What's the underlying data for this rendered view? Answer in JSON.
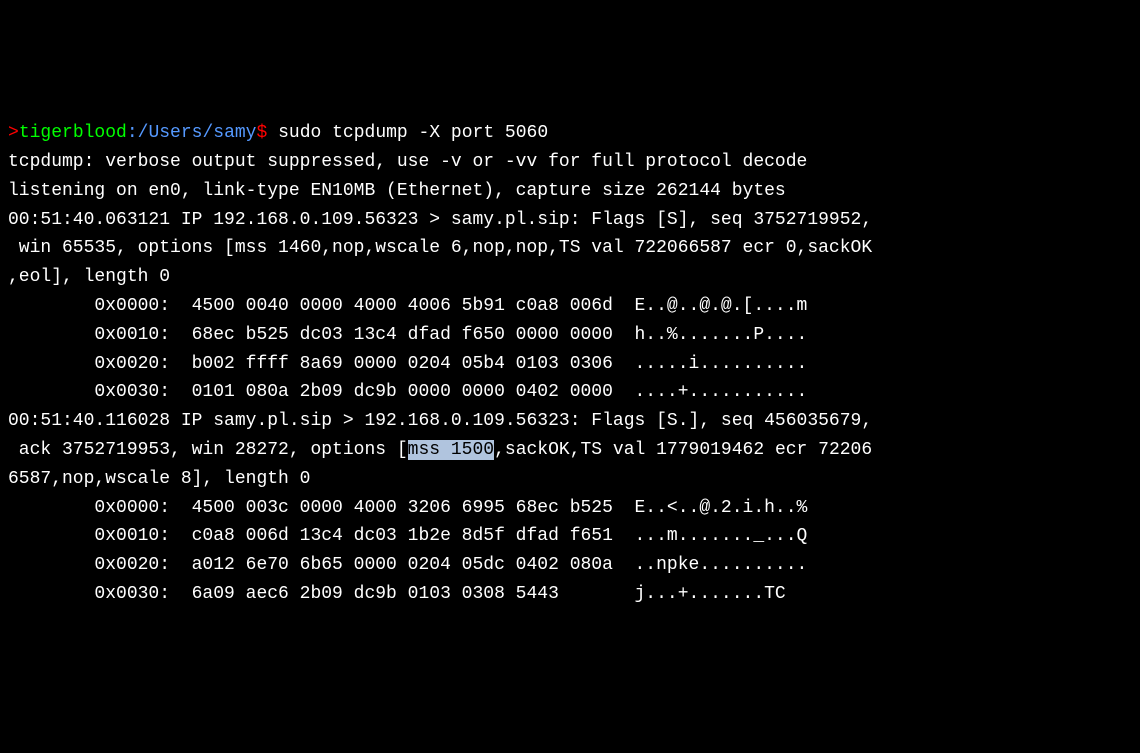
{
  "prompt": {
    "marker": ">",
    "host": "tigerblood",
    "sep": ":",
    "path": "/Users/samy",
    "dollar": "$",
    "command": " sudo tcpdump -X port 5060"
  },
  "output": {
    "line1": "tcpdump: verbose output suppressed, use -v or -vv for full protocol decode",
    "line2": "listening on en0, link-type EN10MB (Ethernet), capture size 262144 bytes",
    "line3": "00:51:40.063121 IP 192.168.0.109.56323 > samy.pl.sip: Flags [S], seq 3752719952,",
    "line4": " win 65535, options [mss 1460,nop,wscale 6,nop,nop,TS val 722066587 ecr 0,sackOK",
    "line5": ",eol], length 0",
    "hex1_0": "        0x0000:  4500 0040 0000 4000 4006 5b91 c0a8 006d  E..@..@.@.[....m",
    "hex1_1": "        0x0010:  68ec b525 dc03 13c4 dfad f650 0000 0000  h..%.......P....",
    "hex1_2": "        0x0020:  b002 ffff 8a69 0000 0204 05b4 0103 0306  .....i..........",
    "hex1_3": "        0x0030:  0101 080a 2b09 dc9b 0000 0000 0402 0000  ....+...........",
    "line6": "00:51:40.116028 IP samy.pl.sip > 192.168.0.109.56323: Flags [S.], seq 456035679,",
    "line7_pre": " ack 3752719953, win 28272, options [",
    "line7_hl": "mss 1500",
    "line7_post": ",sackOK,TS val 1779019462 ecr 72206",
    "line8": "6587,nop,wscale 8], length 0",
    "hex2_0": "        0x0000:  4500 003c 0000 4000 3206 6995 68ec b525  E..<..@.2.i.h..%",
    "hex2_1": "        0x0010:  c0a8 006d 13c4 dc03 1b2e 8d5f dfad f651  ...m......._...Q",
    "hex2_2": "        0x0020:  a012 6e70 6b65 0000 0204 05dc 0402 080a  ..npke..........",
    "hex2_3": "        0x0030:  6a09 aec6 2b09 dc9b 0103 0308 5443       j...+.......TC"
  }
}
